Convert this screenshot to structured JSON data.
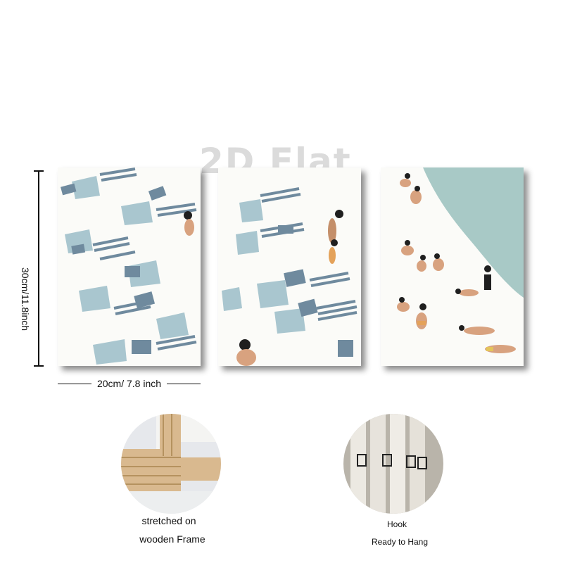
{
  "watermark": "2D Flat",
  "dimensions": {
    "height_label": "30cm/11.8inch",
    "width_label": "20cm/ 7.8 inch"
  },
  "features": {
    "frame": {
      "line1": "stretched on",
      "line2": "wooden Frame"
    },
    "hook": {
      "line1": "Hook",
      "line2": "Ready to Hang"
    }
  },
  "colors": {
    "slate_blue": "#6f8a9e",
    "pale_blue": "#a9c6cf",
    "sea": "#a8c9c6",
    "skin": "#d8a27f",
    "wood": "#d9b98f"
  }
}
